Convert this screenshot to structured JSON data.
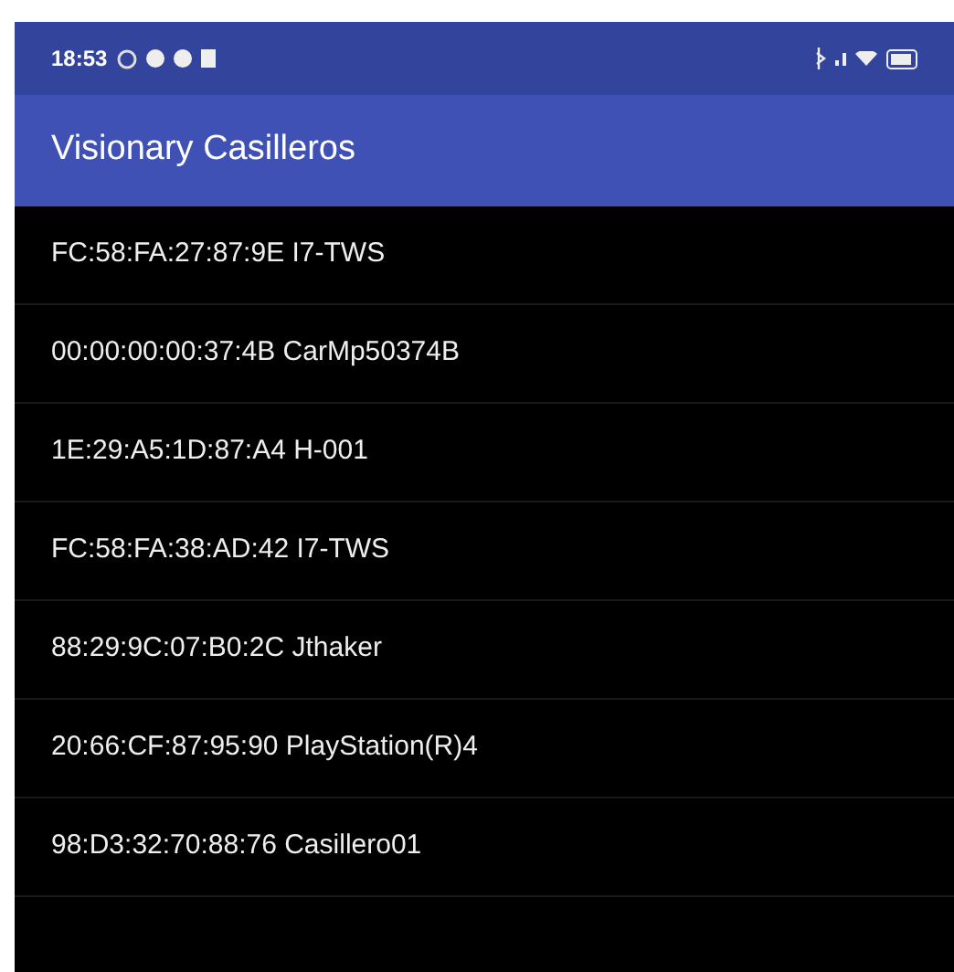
{
  "status_bar": {
    "time": "18:53"
  },
  "app_bar": {
    "title": "Visionary Casilleros"
  },
  "devices": [
    {
      "label": "FC:58:FA:27:87:9E I7-TWS"
    },
    {
      "label": "00:00:00:00:37:4B CarMp50374B"
    },
    {
      "label": "1E:29:A5:1D:87:A4 H-001"
    },
    {
      "label": "FC:58:FA:38:AD:42 I7-TWS"
    },
    {
      "label": "88:29:9C:07:B0:2C Jthaker"
    },
    {
      "label": "20:66:CF:87:95:90 PlayStation(R)4"
    },
    {
      "label": "98:D3:32:70:88:76 Casillero01"
    }
  ]
}
